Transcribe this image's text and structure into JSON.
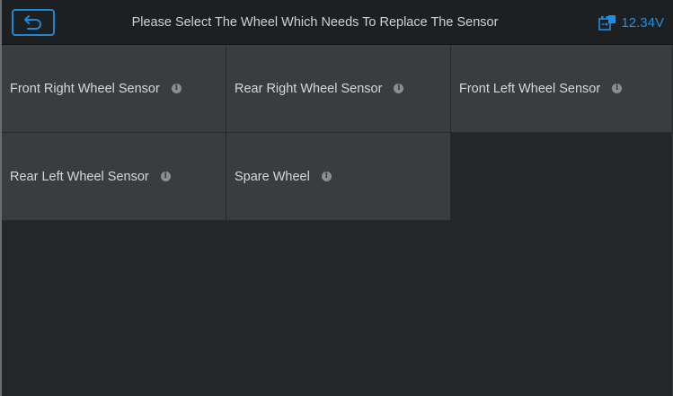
{
  "header": {
    "title": "Please Select The Wheel Which Needs To Replace The Sensor",
    "battery_voltage": "12.34V",
    "back_icon": "back-arrow-icon",
    "battery_icon": "car-battery-icon",
    "accent_color": "#1f86d6"
  },
  "wheels": [
    {
      "label": "Front Right Wheel Sensor"
    },
    {
      "label": "Rear Right Wheel Sensor"
    },
    {
      "label": "Front Left Wheel Sensor"
    },
    {
      "label": "Rear Left Wheel Sensor"
    },
    {
      "label": "Spare Wheel"
    }
  ],
  "info_glyph": "i"
}
